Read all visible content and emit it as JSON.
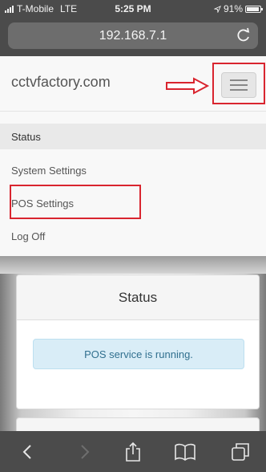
{
  "status_bar": {
    "carrier": "T-Mobile",
    "network": "LTE",
    "time": "5:25 PM",
    "battery": "91%",
    "battery_level": 0.91
  },
  "browser": {
    "url": "192.168.7.1"
  },
  "site": {
    "brand": "cctvfactory.com"
  },
  "nav": {
    "items": [
      {
        "label": "Status"
      },
      {
        "label": "System Settings"
      },
      {
        "label": "POS Settings"
      },
      {
        "label": "Log Off"
      }
    ]
  },
  "panel": {
    "title": "Status",
    "alert": "POS service is running."
  },
  "colors": {
    "highlight": "#d9252f",
    "alert_bg": "#d9edf7",
    "alert_text": "#31708f",
    "chrome": "#4b4b4b"
  },
  "icons": {
    "reload": "reload-icon",
    "menu": "hamburger-menu-icon",
    "arrow": "right-arrow-icon",
    "back": "back-chevron-icon",
    "forward": "forward-chevron-icon",
    "share": "share-icon",
    "bookmarks": "book-icon",
    "tabs": "tabs-icon"
  }
}
